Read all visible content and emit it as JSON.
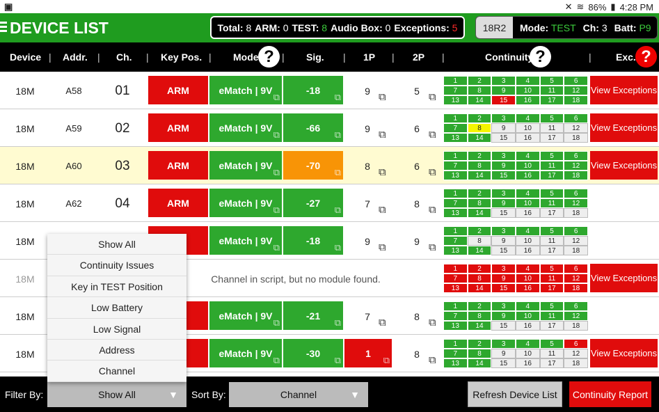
{
  "status": {
    "battery": "86%",
    "time": "4:28 PM"
  },
  "header": {
    "title": "DEVICE LIST",
    "summary": {
      "total_label": "Total:",
      "total": "8",
      "arm_label": "ARM:",
      "arm": "0",
      "test_label": "TEST:",
      "test": "8",
      "audio_label": "Audio Box:",
      "audio": "0",
      "exc_label": "Exceptions:",
      "exc": "5"
    },
    "device": {
      "id": "18R2",
      "mode_label": "Mode:",
      "mode": "TEST",
      "ch_label": "Ch:",
      "ch": "3",
      "batt_label": "Batt:",
      "batt": "P9"
    }
  },
  "columns": {
    "device": "Device",
    "addr": "Addr.",
    "ch": "Ch.",
    "key": "Key Pos.",
    "mode": "Mode",
    "sig": "Sig.",
    "p1": "1P",
    "p2": "2P",
    "continuity": "Continuity",
    "exc": "Exc."
  },
  "rows": [
    {
      "device": "18M",
      "addr": "A58",
      "ch": "01",
      "key": "ARM",
      "mode": "eMatch | 9V",
      "sig": "-18",
      "p1": "9",
      "p2": "5",
      "exc": "View Exceptions"
    },
    {
      "device": "18M",
      "addr": "A59",
      "ch": "02",
      "key": "ARM",
      "mode": "eMatch | 9V",
      "sig": "-66",
      "p1": "9",
      "p2": "6",
      "exc": "View Exceptions"
    },
    {
      "device": "18M",
      "addr": "A60",
      "ch": "03",
      "key": "ARM",
      "mode": "eMatch | 9V",
      "sig": "-70",
      "p1": "8",
      "p2": "6",
      "exc": "View Exceptions"
    },
    {
      "device": "18M",
      "addr": "A62",
      "ch": "04",
      "key": "ARM",
      "mode": "eMatch | 9V",
      "sig": "-27",
      "p1": "7",
      "p2": "8",
      "exc": ""
    },
    {
      "device": "18M",
      "addr": "",
      "ch": "",
      "key": "",
      "mode": "eMatch | 9V",
      "sig": "-18",
      "p1": "9",
      "p2": "9",
      "exc": ""
    },
    {
      "device": "18M",
      "addr": "",
      "ch": "",
      "key": "",
      "mode": "",
      "sig": "",
      "p1": "",
      "p2": "",
      "exc": "View Exceptions",
      "message": "Channel in script, but no module found."
    },
    {
      "device": "18M",
      "addr": "",
      "ch": "",
      "key": "",
      "mode": "eMatch | 9V",
      "sig": "-21",
      "p1": "7",
      "p2": "8",
      "exc": ""
    },
    {
      "device": "18M",
      "addr": "",
      "ch": "",
      "key": "",
      "mode": "eMatch | 9V",
      "sig": "-30",
      "p1": "1",
      "p2": "8",
      "exc": "View Exceptions"
    }
  ],
  "continuity_numbers": [
    "1",
    "2",
    "3",
    "4",
    "5",
    "6",
    "7",
    "8",
    "9",
    "10",
    "11",
    "12",
    "13",
    "14",
    "15",
    "16",
    "17",
    "18"
  ],
  "filter_menu": [
    "Show All",
    "Continuity Issues",
    "Key in TEST Position",
    "Low Battery",
    "Low Signal",
    "Address",
    "Channel"
  ],
  "footer": {
    "filter_label": "Filter By:",
    "filter_value": "Show All",
    "sort_label": "Sort By:",
    "sort_value": "Channel",
    "refresh": "Refresh Device List",
    "report": "Continuity Report"
  }
}
